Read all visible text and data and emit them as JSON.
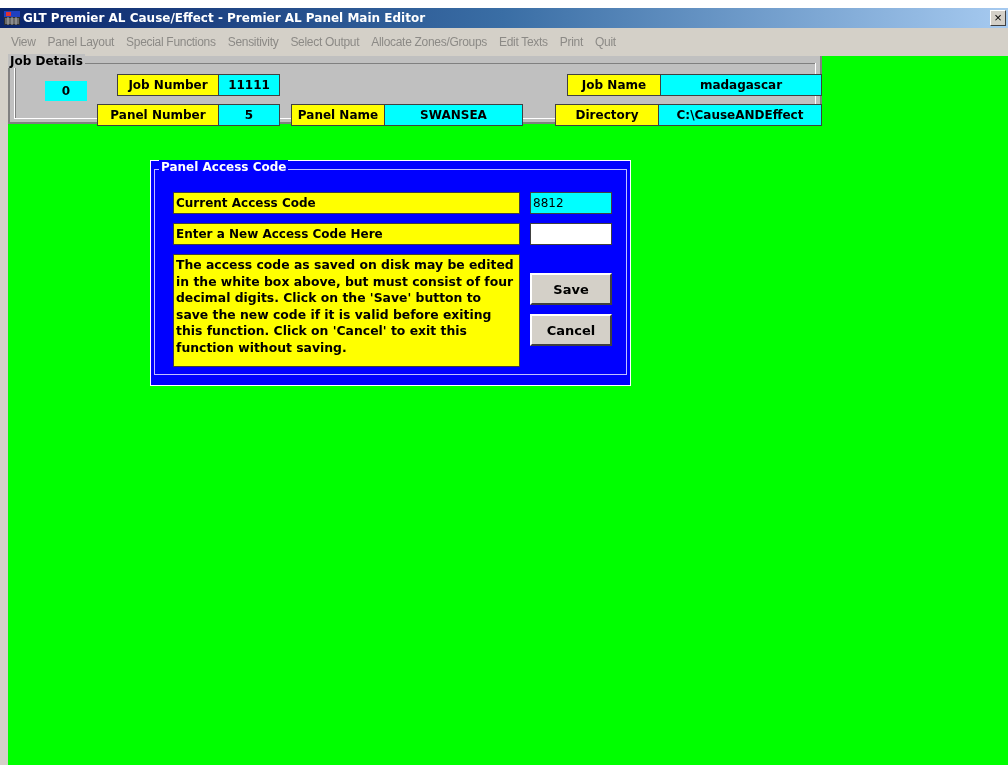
{
  "window": {
    "title": "GLT Premier AL Cause/Effect - Premier AL Panel Main Editor",
    "close": "×"
  },
  "menu": [
    {
      "label": "View",
      "disabled": true
    },
    {
      "label": "Panel Layout",
      "disabled": true
    },
    {
      "label": "Special Functions",
      "disabled": true
    },
    {
      "label": "Sensitivity",
      "disabled": true
    },
    {
      "label": "Select Output",
      "disabled": true
    },
    {
      "label": "Allocate Zones/Groups",
      "disabled": true
    },
    {
      "label": "Edit Texts",
      "disabled": true
    },
    {
      "label": "Print",
      "disabled": true
    },
    {
      "label": "Quit",
      "disabled": true
    }
  ],
  "job_details": {
    "title": "Job Details",
    "counter": "0",
    "fields": [
      {
        "label": "Job Number",
        "value": "11111"
      },
      {
        "label": "Job Name",
        "value": "madagascar"
      },
      {
        "label": "Panel Number",
        "value": "5"
      },
      {
        "label": "Panel Name",
        "value": "SWANSEA"
      },
      {
        "label": "Directory",
        "value": "C:\\CauseANDEffect"
      }
    ]
  },
  "dialog": {
    "title": "Panel Access Code",
    "current": {
      "label": "Current Access Code",
      "value": "8812"
    },
    "new": {
      "label": "Enter a New Access Code Here"
    },
    "description": "The access code as saved on disk may be edited in the white box above, but must consist of four decimal digits. Click on the 'Save' button to save the new code if it is valid before exiting this function. Click on 'Cancel' to exit this function without saving.",
    "buttons": [
      "Save",
      "Cancel"
    ]
  }
}
